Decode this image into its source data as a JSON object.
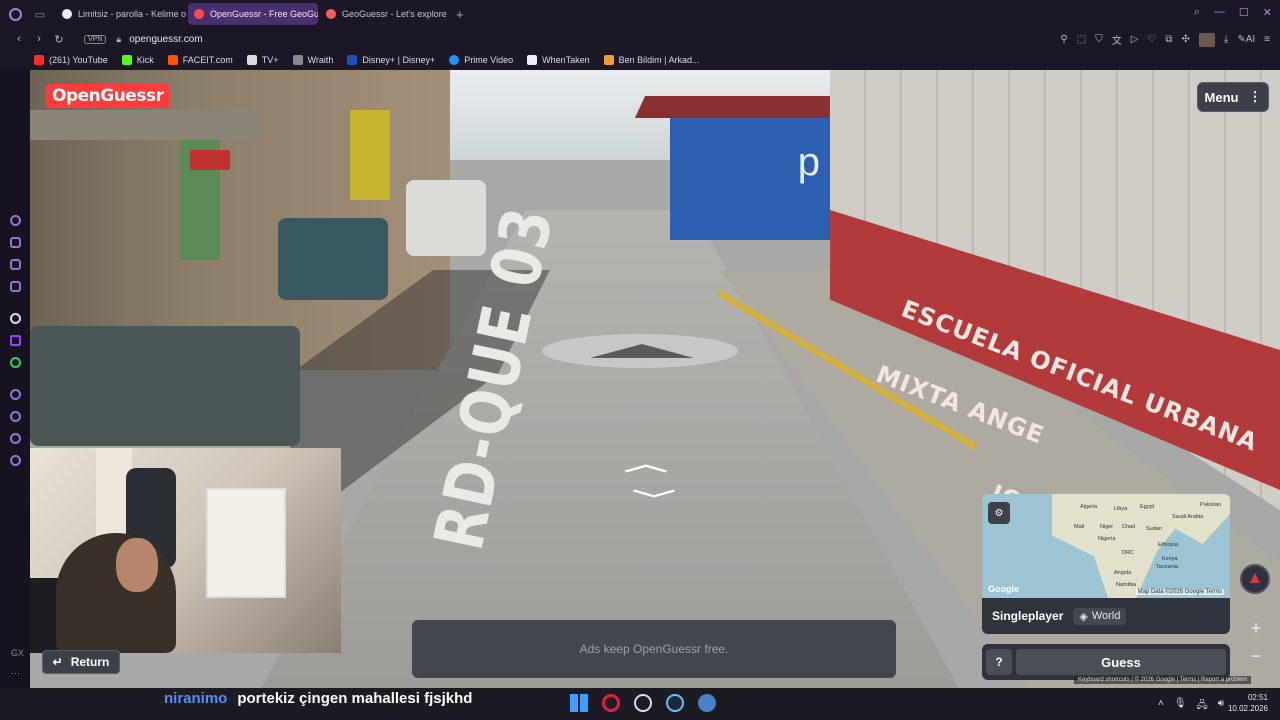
{
  "browser": {
    "tabs": [
      {
        "label": "Limitsiz - parolla - Kelime o",
        "favicon_color": "#ffffff"
      },
      {
        "label": "OpenGuessr - Free GeoGu",
        "favicon_color": "#ff4b4b",
        "active": true
      },
      {
        "label": "GeoGuessr - Let's explore",
        "favicon_color": "#ff5a5a"
      }
    ],
    "vpn_label": "VPN",
    "url": "openguessr.com",
    "ai_label": "AI",
    "bookmarks": [
      {
        "label": "(261) YouTube",
        "color": "#ff2a2a"
      },
      {
        "label": "Kick",
        "color": "#53fc18"
      },
      {
        "label": "FACEIT.com",
        "color": "#ff5500"
      },
      {
        "label": "TV+",
        "color": "#dddddd"
      },
      {
        "label": "Wraith",
        "color": "#8a8a8a"
      },
      {
        "label": "Disney+ | Disney+",
        "color": "#1f4fbf"
      },
      {
        "label": "Prime Video",
        "color": "#1a98ff"
      },
      {
        "label": "WhenTaken",
        "color": "#eeeeee"
      },
      {
        "label": "Ben Bildim | Arkad...",
        "color": "#f0a030"
      }
    ]
  },
  "game": {
    "brand": "OpenGuessr",
    "menu_label": "Menu",
    "street_text": "RD-QUE 03",
    "wall_text_line1": "ESCUELA OFICIAL URBANA MIXTA ANGE",
    "wall_text_line2": "JORNADA VESPER",
    "house_letter": "p",
    "return_label": "Return",
    "ads_text": "Ads keep OpenGuessr free.",
    "minimap": {
      "labels": [
        "Algeria",
        "Libya",
        "Egypt",
        "Saudi Arabia",
        "Mali",
        "Niger",
        "Chad",
        "Sudan",
        "Nigeria",
        "Ethiopia",
        "DRC",
        "Kenya",
        "Tanzania",
        "Angola",
        "Namibia",
        "Pakistan"
      ],
      "google_logo": "Google",
      "credit": "Map Data ©2026 Google",
      "terms": "Terms"
    },
    "mode_label": "Singleplayer",
    "map_chip_label": "World",
    "help_label": "?",
    "guess_label": "Guess",
    "zoom_in": "+",
    "zoom_out": "−",
    "google_footer": "Keyboard shortcuts | © 2026 Google | Terms | Report a problem"
  },
  "chat": {
    "username": "niranimo",
    "message": "portekiz çingen mahallesi fjsjkhd"
  },
  "taskbar": {
    "time": "02:51",
    "date": "10.02.2026"
  }
}
